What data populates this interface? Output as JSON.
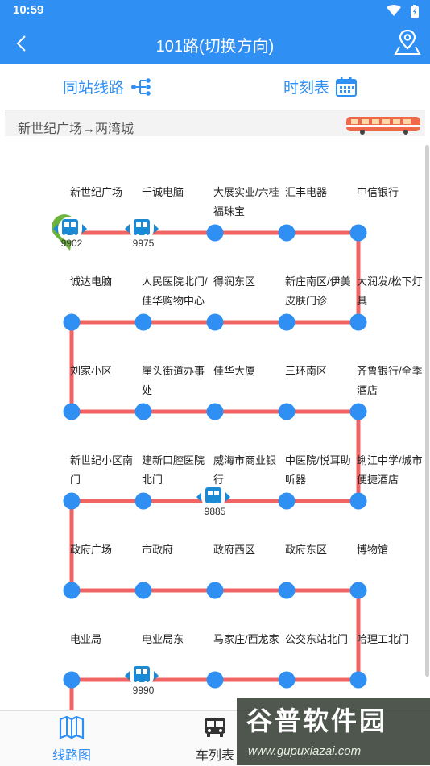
{
  "status": {
    "time": "10:59"
  },
  "header": {
    "title": "101路(切换方向)"
  },
  "tabs": {
    "same_station": "同站线路",
    "timetable": "时刻表"
  },
  "direction": "新世纪广场→两湾城",
  "colors": {
    "primary": "#2f8ff2",
    "route_line": "#f06464",
    "stop_dot": "#2f8ff2",
    "bus_icon": "#1a8ad4",
    "start_marker": "#6cb33e"
  },
  "stops": [
    {
      "name": "新世纪广场"
    },
    {
      "name": "千诚电脑"
    },
    {
      "name": "大展实业/六桂福珠宝"
    },
    {
      "name": "汇丰电器"
    },
    {
      "name": "中信银行"
    },
    {
      "name": "大润发/松下灯具"
    },
    {
      "name": "新庄南区/伊美皮肤门诊"
    },
    {
      "name": "得润东区"
    },
    {
      "name": "人民医院北门/佳华购物中心"
    },
    {
      "name": "诚达电脑"
    },
    {
      "name": "刘家小区"
    },
    {
      "name": "崖头街道办事处"
    },
    {
      "name": "佳华大厦"
    },
    {
      "name": "三环南区"
    },
    {
      "name": "齐鲁银行/全季酒店"
    },
    {
      "name": "蜊江中学/城市便捷酒店"
    },
    {
      "name": "中医院/悦耳助听器"
    },
    {
      "name": "威海市商业银行"
    },
    {
      "name": "建新口腔医院北门"
    },
    {
      "name": "新世纪小区南门"
    },
    {
      "name": "政府广场"
    },
    {
      "name": "市政府"
    },
    {
      "name": "政府西区"
    },
    {
      "name": "政府东区"
    },
    {
      "name": "博物馆"
    },
    {
      "name": "哈理工北门"
    },
    {
      "name": "公交东站北门"
    },
    {
      "name": "马家庄/西龙家"
    },
    {
      "name": "电业局东"
    },
    {
      "name": "电业局"
    }
  ],
  "buses": [
    {
      "id": "9902",
      "row": 0,
      "col": 0
    },
    {
      "id": "9975",
      "row": 0,
      "col": 1
    },
    {
      "id": "9885",
      "row": 3,
      "col": 2
    },
    {
      "id": "9990",
      "row": 5,
      "col": 1
    }
  ],
  "nav": {
    "route_map": "线路图",
    "bus_list": "车列表"
  },
  "watermark": {
    "title": "谷普软件园",
    "url": "www.gupuxiazai.com"
  }
}
